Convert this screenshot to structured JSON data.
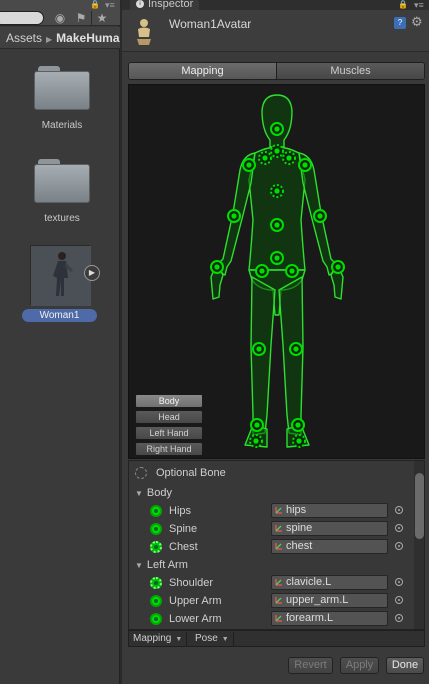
{
  "project_panel": {
    "breadcrumb": [
      "Assets",
      "MakeHuma"
    ],
    "assets": [
      {
        "label": "Materials",
        "icon": "folder-icon"
      },
      {
        "label": "textures",
        "icon": "folder-icon"
      }
    ],
    "avatar_asset_label": "Woman1"
  },
  "inspector": {
    "tab_label": "Inspector",
    "object_title": "Woman1Avatar",
    "tabs": [
      {
        "label": "Mapping",
        "active": true
      },
      {
        "label": "Muscles",
        "active": false
      }
    ],
    "view_buttons": [
      {
        "label": "Body",
        "active": true
      },
      {
        "label": "Head",
        "active": false
      },
      {
        "label": "Left Hand",
        "active": false
      },
      {
        "label": "Right Hand",
        "active": false
      }
    ],
    "optional_bone_label": "Optional Bone",
    "groups": [
      {
        "label": "Body",
        "bones": [
          {
            "name": "Hips",
            "value": "hips",
            "optional": false
          },
          {
            "name": "Spine",
            "value": "spine",
            "optional": false
          },
          {
            "name": "Chest",
            "value": "chest",
            "optional": true
          }
        ]
      },
      {
        "label": "Left Arm",
        "bones": [
          {
            "name": "Shoulder",
            "value": "clavicle.L",
            "optional": true
          },
          {
            "name": "Upper Arm",
            "value": "upper_arm.L",
            "optional": false
          },
          {
            "name": "Lower Arm",
            "value": "forearm.L",
            "optional": false
          }
        ]
      }
    ],
    "bottom_dropdowns": [
      "Mapping",
      "Pose"
    ],
    "actions": [
      {
        "label": "Revert",
        "enabled": false
      },
      {
        "label": "Apply",
        "enabled": false
      },
      {
        "label": "Done",
        "enabled": true
      }
    ]
  },
  "colors": {
    "mapped_green": "#00dd00",
    "figure_outline": "#22cc22",
    "selection_blue": "#4f6aa8"
  }
}
